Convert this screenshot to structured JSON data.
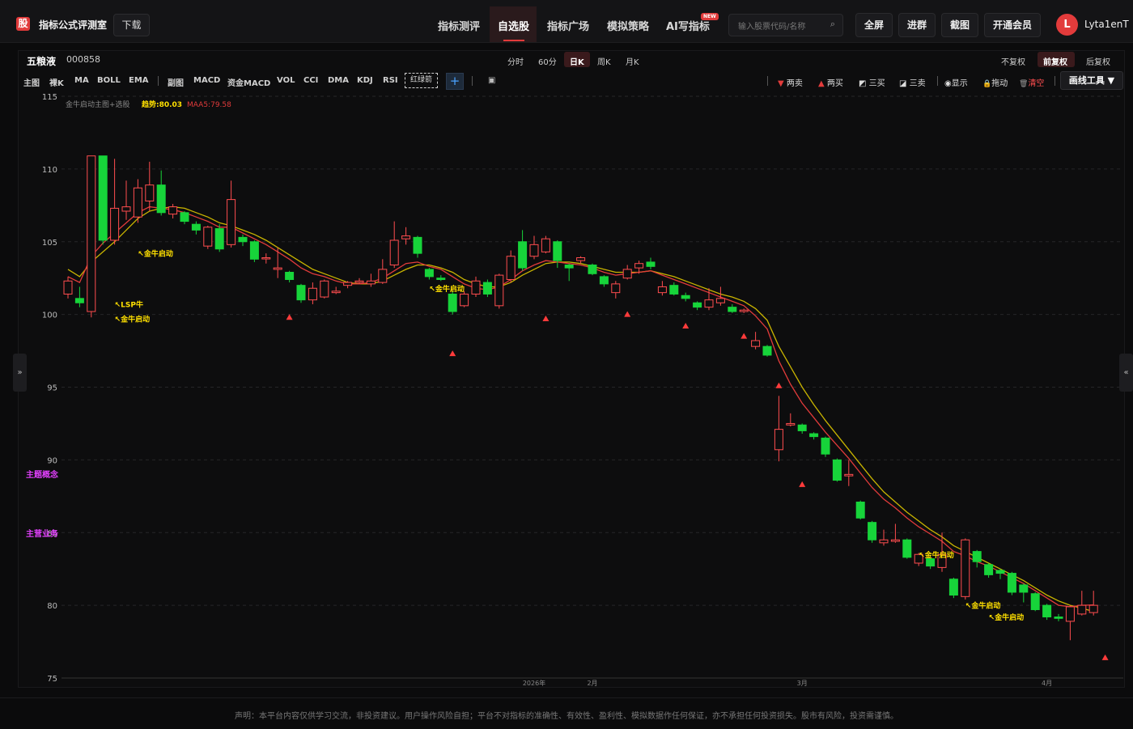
{
  "topbar": {
    "logo_text": "股",
    "brand": "指标公式评测室",
    "download": "下载",
    "nav": [
      {
        "label": "指标测评",
        "active": false
      },
      {
        "label": "自选股",
        "active": true
      },
      {
        "label": "指标广场",
        "active": false
      },
      {
        "label": "模拟策略",
        "active": false
      },
      {
        "label": "AI写指标",
        "active": false,
        "badge": "NEW"
      }
    ],
    "search_placeholder": "输入股票代码/名称",
    "buttons": [
      "全屏",
      "进群",
      "截图",
      "开通会员"
    ],
    "avatar_letter": "L",
    "username": "Lyta1enT"
  },
  "stock": {
    "name": "五粮液",
    "code": "000858"
  },
  "periods": [
    "分时",
    "60分",
    "日K",
    "周K",
    "月K"
  ],
  "active_period": "日K",
  "adjust": [
    "不复权",
    "前复权",
    "后复权"
  ],
  "active_adjust": "前复权",
  "indicators_main": [
    "主图",
    "裸K",
    "MA",
    "BOLL",
    "EMA"
  ],
  "indicators_sub": [
    "副图",
    "MACD",
    "资金MACD",
    "VOL",
    "CCI",
    "DMA",
    "KDJ",
    "RSI"
  ],
  "redgreen_label": "红绿箭",
  "plus_label": "+",
  "tools": [
    {
      "icon": "sell-triangle-icon",
      "glyph": "▼",
      "color": "#e23b3b",
      "label": "两卖"
    },
    {
      "icon": "buy-triangle-icon",
      "glyph": "▲",
      "color": "#e23b3b",
      "label": "两买"
    },
    {
      "icon": "three-buy-icon",
      "glyph": "◩",
      "color": "#dddddd",
      "label": "三买"
    },
    {
      "icon": "three-sell-icon",
      "glyph": "◪",
      "color": "#dddddd",
      "label": "三卖"
    },
    {
      "icon": "eye-icon",
      "glyph": "◉",
      "color": "#dddddd",
      "label": "显示"
    },
    {
      "icon": "lock-icon",
      "glyph": "🔒",
      "color": "#e8c33a",
      "label": "拖动"
    },
    {
      "icon": "trash-icon",
      "glyph": "🗑",
      "color": "#999999",
      "label": "清空"
    }
  ],
  "drawtool_label": "画线工具 ▼",
  "legend": {
    "formula": "金牛启动主图+选股",
    "trend": "趋势:80.03",
    "maa": "MAA5:79.58"
  },
  "side_left": "»",
  "side_right": "«",
  "side_labels": [
    "主题概念",
    "主营业务"
  ],
  "footer": "声明：本平台内容仅供学习交流，非投资建议。用户操作风险自担；平台不对指标的准确性、有效性、盈利性、模拟数据作任何保证，亦不承担任何投资损失。股市有风险，投资需谨慎。",
  "chart_data": {
    "type": "candlestick",
    "y_ticks": [
      115,
      110,
      105,
      100,
      95,
      90,
      85,
      80,
      75
    ],
    "ylim": [
      75,
      115
    ],
    "x_labels": [
      "2026年",
      "2月",
      "3月",
      "4月"
    ],
    "x_label_idx": [
      40,
      45,
      63,
      84
    ],
    "colors": {
      "up": "#ff4d4f",
      "down": "#17d43a",
      "trend": "#e23b3b",
      "maa": "#c9b400",
      "label": "#ffe000",
      "grid": "#262628"
    },
    "candles": [
      [
        101.4,
        102.3,
        102.6,
        101.1
      ],
      [
        101.1,
        100.8,
        101.9,
        100.5
      ],
      [
        100.2,
        110.9,
        110.9,
        99.8
      ],
      [
        110.9,
        105.1,
        110.9,
        104.8
      ],
      [
        105.1,
        107.3,
        110.7,
        104.8
      ],
      [
        107.1,
        107.4,
        109.2,
        106.5
      ],
      [
        106.7,
        108.7,
        109.3,
        106.3
      ],
      [
        107.8,
        108.9,
        110.5,
        107.1
      ],
      [
        108.9,
        107.0,
        109.9,
        106.8
      ],
      [
        106.9,
        107.4,
        107.6,
        106.6
      ],
      [
        107.0,
        106.4,
        107.1,
        106.2
      ],
      [
        106.2,
        105.8,
        106.4,
        105.5
      ],
      [
        104.7,
        106.0,
        106.1,
        104.5
      ],
      [
        105.9,
        104.5,
        106.2,
        104.3
      ],
      [
        104.8,
        107.9,
        109.2,
        104.6
      ],
      [
        105.3,
        105.0,
        105.5,
        104.7
      ],
      [
        105.0,
        103.8,
        105.1,
        103.6
      ],
      [
        103.9,
        103.9,
        104.2,
        103.5
      ],
      [
        103.1,
        103.2,
        104.6,
        102.5
      ],
      [
        102.9,
        102.4,
        103.0,
        102.2
      ],
      [
        102.0,
        101.0,
        102.1,
        100.8
      ],
      [
        101.0,
        101.8,
        102.2,
        100.7
      ],
      [
        101.2,
        102.3,
        102.4,
        101.1
      ],
      [
        101.5,
        101.6,
        101.9,
        101.4
      ],
      [
        102.0,
        102.2,
        102.3,
        101.8
      ],
      [
        102.2,
        102.3,
        102.5,
        102.1
      ],
      [
        102.1,
        102.3,
        102.8,
        101.9
      ],
      [
        102.2,
        103.1,
        103.8,
        102.1
      ],
      [
        103.4,
        105.1,
        106.4,
        103.2
      ],
      [
        105.2,
        105.4,
        106.0,
        104.8
      ],
      [
        105.3,
        104.2,
        105.4,
        103.9
      ],
      [
        103.1,
        102.6,
        103.2,
        102.4
      ],
      [
        102.5,
        102.4,
        102.7,
        102.3
      ],
      [
        101.4,
        100.2,
        101.6,
        100.0
      ],
      [
        100.6,
        101.4,
        101.6,
        100.5
      ],
      [
        101.4,
        102.3,
        102.6,
        101.2
      ],
      [
        102.2,
        101.4,
        102.4,
        101.2
      ],
      [
        100.6,
        102.7,
        102.8,
        100.4
      ],
      [
        102.4,
        104.0,
        104.4,
        102.2
      ],
      [
        105.0,
        103.2,
        105.8,
        103.0
      ],
      [
        104.0,
        104.8,
        105.4,
        103.8
      ],
      [
        104.3,
        105.2,
        105.4,
        104.2
      ],
      [
        105.0,
        103.7,
        105.1,
        103.2
      ],
      [
        103.4,
        103.2,
        103.5,
        102.3
      ],
      [
        103.7,
        103.9,
        104.0,
        103.5
      ],
      [
        103.4,
        102.8,
        103.5,
        102.7
      ],
      [
        102.6,
        102.1,
        102.7,
        101.9
      ],
      [
        101.5,
        102.1,
        102.3,
        101.1
      ],
      [
        102.5,
        103.1,
        103.4,
        102.4
      ],
      [
        103.2,
        103.5,
        103.7,
        102.8
      ],
      [
        103.6,
        103.3,
        103.9,
        103.1
      ],
      [
        101.5,
        101.9,
        102.3,
        101.3
      ],
      [
        102.0,
        101.4,
        102.2,
        101.3
      ],
      [
        101.3,
        101.1,
        101.5,
        100.9
      ],
      [
        100.8,
        100.5,
        100.9,
        100.3
      ],
      [
        100.5,
        101.0,
        101.8,
        100.3
      ],
      [
        100.8,
        101.1,
        101.9,
        100.6
      ],
      [
        100.5,
        100.2,
        100.7,
        100.1
      ],
      [
        100.2,
        100.3,
        100.4,
        100.1
      ],
      [
        97.8,
        98.2,
        98.8,
        97.6
      ],
      [
        97.8,
        97.2,
        97.9,
        97.1
      ],
      [
        90.7,
        92.1,
        94.4,
        89.9
      ],
      [
        92.4,
        92.5,
        93.2,
        92.3
      ],
      [
        92.4,
        92.0,
        92.5,
        91.8
      ],
      [
        91.8,
        91.6,
        91.9,
        91.4
      ],
      [
        91.5,
        90.4,
        91.6,
        90.2
      ],
      [
        90.0,
        88.6,
        90.1,
        88.5
      ],
      [
        88.9,
        89.0,
        90.0,
        88.2
      ],
      [
        87.1,
        86.0,
        87.2,
        85.9
      ],
      [
        85.7,
        84.5,
        85.8,
        84.3
      ],
      [
        84.3,
        84.5,
        85.2,
        84.1
      ],
      [
        84.4,
        84.5,
        85.6,
        84.3
      ],
      [
        84.5,
        83.3,
        84.6,
        83.2
      ],
      [
        82.9,
        83.5,
        83.6,
        82.7
      ],
      [
        83.2,
        82.7,
        83.3,
        82.5
      ],
      [
        82.6,
        83.5,
        85.0,
        82.3
      ],
      [
        81.8,
        80.7,
        81.9,
        80.5
      ],
      [
        80.6,
        84.5,
        84.6,
        80.4
      ],
      [
        83.7,
        83.0,
        83.8,
        82.6
      ],
      [
        82.8,
        82.1,
        82.9,
        81.9
      ],
      [
        82.4,
        82.2,
        82.5,
        81.8
      ],
      [
        82.2,
        80.9,
        82.3,
        80.7
      ],
      [
        81.4,
        80.9,
        81.5,
        80.2
      ],
      [
        80.8,
        79.7,
        80.9,
        79.6
      ],
      [
        80.0,
        79.2,
        80.1,
        79.0
      ],
      [
        79.2,
        79.1,
        79.4,
        78.9
      ],
      [
        78.9,
        79.9,
        80.0,
        77.6
      ],
      [
        79.4,
        80.0,
        81.0,
        79.3
      ],
      [
        79.5,
        80.0,
        81.0,
        79.3
      ]
    ],
    "trend_line": [
      102.6,
      102.2,
      104.0,
      104.9,
      105.6,
      106.3,
      107.0,
      107.4,
      107.3,
      107.2,
      107.0,
      106.7,
      106.4,
      106.0,
      106.0,
      105.6,
      105.2,
      104.8,
      104.3,
      103.8,
      103.2,
      102.8,
      102.6,
      102.3,
      102.1,
      102.1,
      102.2,
      102.5,
      103.0,
      103.5,
      103.6,
      103.3,
      103.1,
      102.6,
      102.1,
      101.8,
      101.7,
      101.9,
      102.4,
      103.0,
      103.4,
      103.7,
      103.6,
      103.5,
      103.4,
      103.2,
      102.9,
      102.7,
      102.8,
      102.9,
      103.0,
      102.7,
      102.4,
      102.1,
      101.8,
      101.5,
      101.2,
      100.9,
      100.6,
      99.9,
      99.0,
      96.8,
      95.2,
      93.9,
      92.9,
      91.9,
      91.0,
      90.1,
      89.1,
      88.1,
      87.3,
      86.7,
      86.0,
      85.4,
      84.9,
      84.4,
      83.7,
      83.4,
      83.0,
      82.7,
      82.3,
      81.9,
      81.5,
      81.0,
      80.5,
      80.0,
      79.9,
      80.0,
      80.03
    ],
    "maa_line": [
      103.1,
      102.6,
      103.6,
      104.3,
      105.0,
      105.8,
      106.6,
      107.1,
      107.3,
      107.4,
      107.3,
      107.0,
      106.7,
      106.3,
      106.1,
      105.8,
      105.5,
      105.1,
      104.6,
      104.1,
      103.6,
      103.1,
      102.8,
      102.5,
      102.2,
      102.1,
      102.1,
      102.3,
      102.7,
      103.1,
      103.4,
      103.4,
      103.2,
      102.9,
      102.4,
      102.1,
      101.9,
      101.9,
      102.2,
      102.7,
      103.1,
      103.5,
      103.6,
      103.6,
      103.5,
      103.3,
      103.1,
      102.9,
      102.9,
      102.9,
      103.0,
      102.8,
      102.6,
      102.3,
      102.0,
      101.7,
      101.4,
      101.2,
      100.9,
      100.4,
      99.6,
      97.8,
      96.4,
      95.0,
      93.8,
      92.7,
      91.7,
      90.7,
      89.7,
      88.7,
      87.8,
      87.1,
      86.4,
      85.8,
      85.2,
      84.7,
      84.1,
      83.7,
      83.3,
      82.9,
      82.5,
      82.1,
      81.7,
      81.2,
      80.7,
      80.3,
      80.0,
      79.8,
      79.58
    ],
    "buy_markers": [
      {
        "i": 19,
        "y": 99.8
      },
      {
        "i": 33,
        "y": 97.3
      },
      {
        "i": 41,
        "y": 99.7
      },
      {
        "i": 48,
        "y": 100.0
      },
      {
        "i": 53,
        "y": 99.2
      },
      {
        "i": 58,
        "y": 98.5
      },
      {
        "i": 61,
        "y": 95.1
      },
      {
        "i": 63,
        "y": 88.3
      },
      {
        "i": 89,
        "y": 76.4
      }
    ],
    "annotations": [
      {
        "i": 6,
        "y": 104.0,
        "text": "↖金牛启动"
      },
      {
        "i": 4,
        "y": 100.5,
        "text": "↖LSP牛"
      },
      {
        "i": 4,
        "y": 99.5,
        "text": "↖金牛启动"
      },
      {
        "i": 31,
        "y": 101.6,
        "text": "↖金牛启动"
      },
      {
        "i": 73,
        "y": 83.3,
        "text": "↖金牛启动"
      },
      {
        "i": 77,
        "y": 79.8,
        "text": "↖金牛启动"
      },
      {
        "i": 79,
        "y": 79.0,
        "text": "↖金牛启动"
      }
    ]
  }
}
